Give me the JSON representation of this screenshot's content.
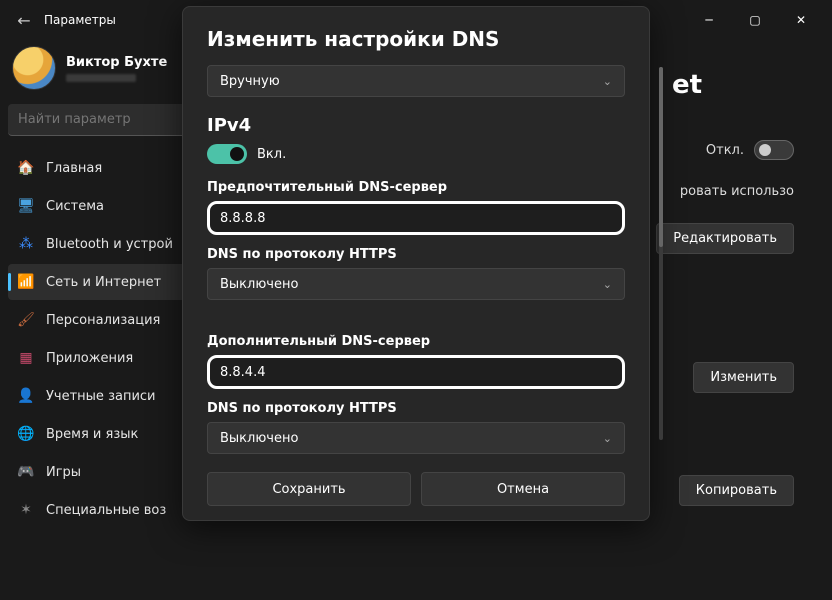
{
  "app": {
    "title": "Параметры"
  },
  "profile": {
    "name": "Виктор Бухте"
  },
  "search": {
    "placeholder": "Найти параметр"
  },
  "sidebar": {
    "items": [
      {
        "label": "Главная",
        "icon": "🏠"
      },
      {
        "label": "Система",
        "icon": "🖥"
      },
      {
        "label": "Bluetooth и устрой",
        "icon": "⁂"
      },
      {
        "label": "Сеть и Интернет",
        "icon": "📶"
      },
      {
        "label": "Персонализация",
        "icon": "🖌"
      },
      {
        "label": "Приложения",
        "icon": "▦"
      },
      {
        "label": "Учетные записи",
        "icon": "👤"
      },
      {
        "label": "Время и язык",
        "icon": "🌐"
      },
      {
        "label": "Игры",
        "icon": "🎮"
      },
      {
        "label": "Специальные воз",
        "icon": "✶"
      }
    ]
  },
  "page": {
    "title_fragment": "et",
    "off_label": "Откл.",
    "usage_fragment": "ровать использо",
    "btn_edit": "Редактировать",
    "btn_change": "Изменить",
    "btn_copy": "Копировать"
  },
  "modal": {
    "title": "Изменить настройки DNS",
    "mode_label": "Вручную",
    "ipv4_heading": "IPv4",
    "ipv4_toggle_label": "Вкл.",
    "preferred_label": "Предпочтительный DNS-сервер",
    "preferred_value": "8.8.8.8",
    "doh1_label": "DNS по протоколу HTTPS",
    "doh1_value": "Выключено",
    "alt_label": "Дополнительный DNS-сервер",
    "alt_value": "8.8.4.4",
    "doh2_label": "DNS по протоколу HTTPS",
    "doh2_value": "Выключено",
    "save": "Сохранить",
    "cancel": "Отмена"
  }
}
